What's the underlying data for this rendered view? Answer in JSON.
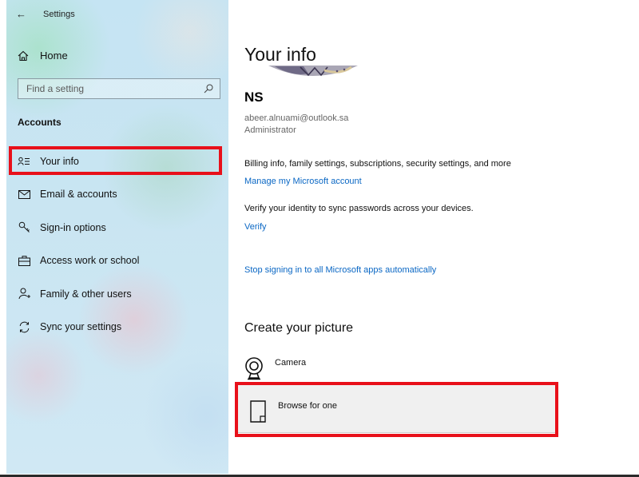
{
  "window": {
    "title": "Settings"
  },
  "sidebar": {
    "home_label": "Home",
    "search": {
      "placeholder": "Find a setting"
    },
    "section_title": "Accounts",
    "items": [
      {
        "label": "Your info",
        "icon": "person-lines-icon",
        "selected": true
      },
      {
        "label": "Email & accounts",
        "icon": "mail-icon"
      },
      {
        "label": "Sign-in options",
        "icon": "key-icon"
      },
      {
        "label": "Access work or school",
        "icon": "briefcase-icon"
      },
      {
        "label": "Family & other users",
        "icon": "person-add-icon"
      },
      {
        "label": "Sync your settings",
        "icon": "sync-icon"
      }
    ]
  },
  "main": {
    "title": "Your info",
    "user": {
      "initials": "NS",
      "email": "abeer.alnuami@outlook.sa",
      "role": "Administrator"
    },
    "billing_text": "Billing info, family settings, subscriptions, security settings, and more",
    "manage_link": "Manage my Microsoft account",
    "verify_text": "Verify your identity to sync passwords across your devices.",
    "verify_link": "Verify",
    "stop_link": "Stop signing in to all Microsoft apps automatically",
    "picture_heading": "Create your picture",
    "options": {
      "camera_label": "Camera",
      "browse_label": "Browse for one"
    }
  },
  "colors": {
    "highlight": "#e8101a",
    "link": "#0a67c4",
    "sidebar_bg": "#c9e5f2"
  }
}
